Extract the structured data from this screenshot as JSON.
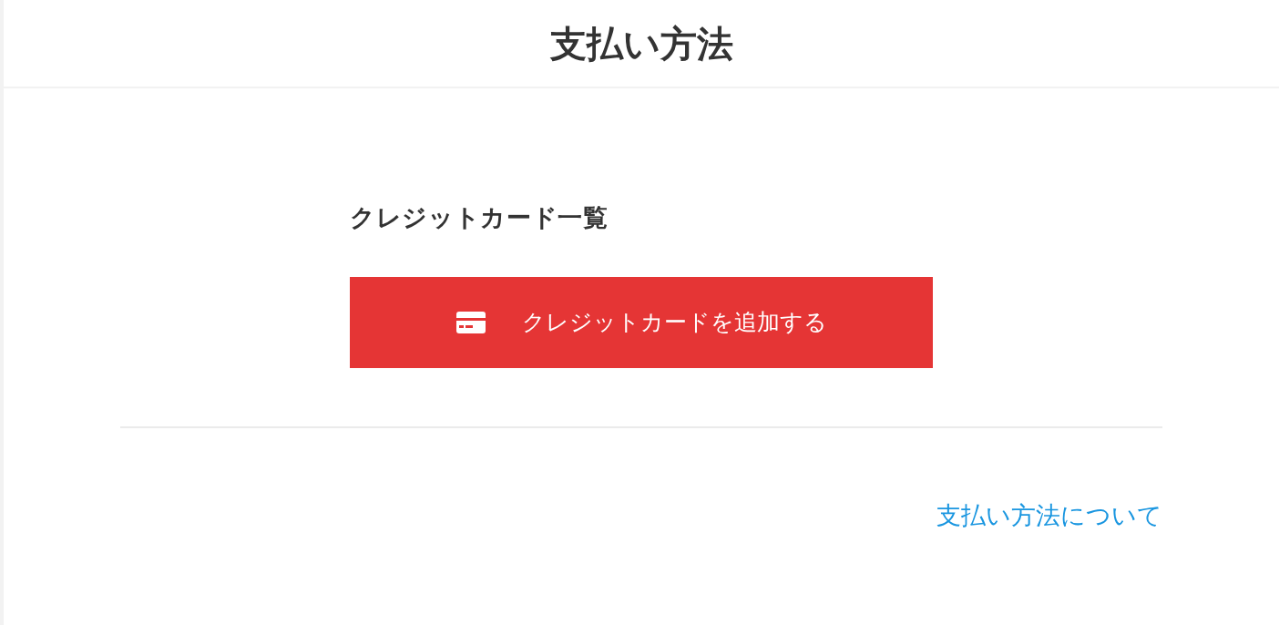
{
  "header": {
    "title": "支払い方法"
  },
  "section": {
    "heading": "クレジットカード一覧"
  },
  "add_button": {
    "label": "クレジットカードを追加する"
  },
  "footer_link": {
    "label": "支払い方法について"
  }
}
